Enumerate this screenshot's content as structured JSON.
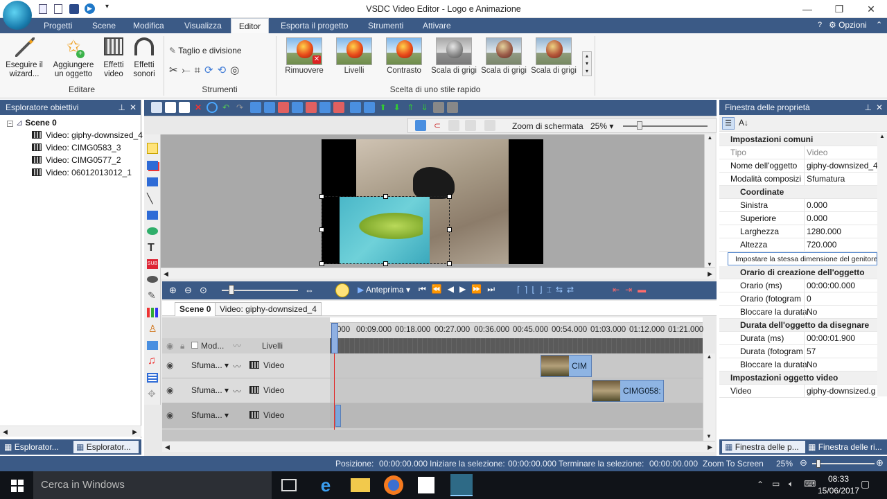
{
  "window": {
    "title": "VSDC Video Editor - Logo e Animazione"
  },
  "tabs": [
    "Progetti",
    "Scene",
    "Modifica",
    "Visualizza",
    "Editor",
    "Esporta il progetto",
    "Strumenti",
    "Attivare"
  ],
  "options_label": "Opzioni",
  "ribbon": {
    "editor_group": {
      "label": "Editare",
      "buttons": [
        "Eseguire il wizard...",
        "Aggiungere un oggetto",
        "Effetti video",
        "Effetti sonori"
      ]
    },
    "tools_group": {
      "label": "Strumenti",
      "cut_split": "Taglio e divisione"
    },
    "style_group": {
      "label": "Scelta di uno stile rapido",
      "styles": [
        "Rimuovere",
        "Livelli",
        "Contrasto",
        "Scala di grigi",
        "Scala di grigi",
        "Scala di grigi"
      ]
    }
  },
  "left_panel": {
    "title": "Esploratore obiettivi",
    "scene": "Scene 0",
    "items": [
      "Video: giphy-downsized_4",
      "Video: CIMG0583_3",
      "Video: CIMG0577_2",
      "Video: 06012013012_1"
    ],
    "bottom_tabs": [
      "Esplorator...",
      "Esplorator..."
    ]
  },
  "preview": {
    "zoom_label": "Zoom di schermata",
    "zoom_value": "25%"
  },
  "timeline": {
    "preview_btn": "Anteprima",
    "tabs": [
      "Scene 0",
      "Video: giphy-downsized_4"
    ],
    "header": {
      "mode": "Mod...",
      "layers": "Livelli"
    },
    "ruler": [
      "000",
      "00:09.000",
      "00:18.000",
      "00:27.000",
      "00:36.000",
      "00:45.000",
      "00:54.000",
      "01:03.000",
      "01:12.000",
      "01:21.000"
    ],
    "tracks": [
      {
        "blend": "Sfuma...",
        "type": "Video",
        "clip": "CIM"
      },
      {
        "blend": "Sfuma...",
        "type": "Video",
        "clip": "CIMG058:"
      },
      {
        "blend": "Sfuma...",
        "type": "Video",
        "clip": ""
      }
    ]
  },
  "right_panel": {
    "title": "Finestra delle proprietà",
    "rows": [
      {
        "section": "Impostazioni comuni"
      },
      {
        "k": "Tipo",
        "v": "Video",
        "muted": true
      },
      {
        "k": "Nome dell'oggetto",
        "v": "giphy-downsized_4"
      },
      {
        "k": "Modalità composizi",
        "v": "Sfumatura"
      },
      {
        "section": "Coordinate",
        "sub": true
      },
      {
        "k": "Sinistra",
        "v": "0.000",
        "indent": true
      },
      {
        "k": "Superiore",
        "v": "0.000",
        "indent": true
      },
      {
        "k": "Larghezza",
        "v": "1280.000",
        "indent": true
      },
      {
        "k": "Altezza",
        "v": "720.000",
        "indent": true
      },
      {
        "button": "Impostare la stessa dimensione del genitore"
      },
      {
        "section": "Orario di creazione dell'oggetto",
        "sub": true
      },
      {
        "k": "Orario (ms)",
        "v": "00:00:00.000",
        "indent": true
      },
      {
        "k": "Orario (fotogram",
        "v": "0",
        "indent": true
      },
      {
        "k": "Bloccare la durata",
        "v": "No",
        "indent": true
      },
      {
        "section": "Durata dell'oggetto da disegnare",
        "sub": true
      },
      {
        "k": "Durata (ms)",
        "v": "00:00:01.900",
        "indent": true
      },
      {
        "k": "Durata (fotogram",
        "v": "57",
        "indent": true
      },
      {
        "k": "Bloccare la durata",
        "v": "No",
        "indent": true
      },
      {
        "section": "Impostazioni oggetto video"
      },
      {
        "k": "Video",
        "v": "giphy-downsized.g"
      }
    ],
    "bottom_tabs": [
      "Finestra delle p...",
      "Finestra delle ri..."
    ]
  },
  "status": {
    "position_label": "Posizione:",
    "position": "00:00:00.000",
    "sel_start_label": "Iniziare la selezione:",
    "sel_start": "00:00:00.000",
    "sel_end_label": "Terminare la selezione:",
    "sel_end": "00:00:00.000",
    "zoom_label": "Zoom To Screen",
    "zoom": "25%"
  },
  "taskbar": {
    "search": "Cerca in Windows",
    "time": "08:33",
    "date": "15/06/2017"
  }
}
